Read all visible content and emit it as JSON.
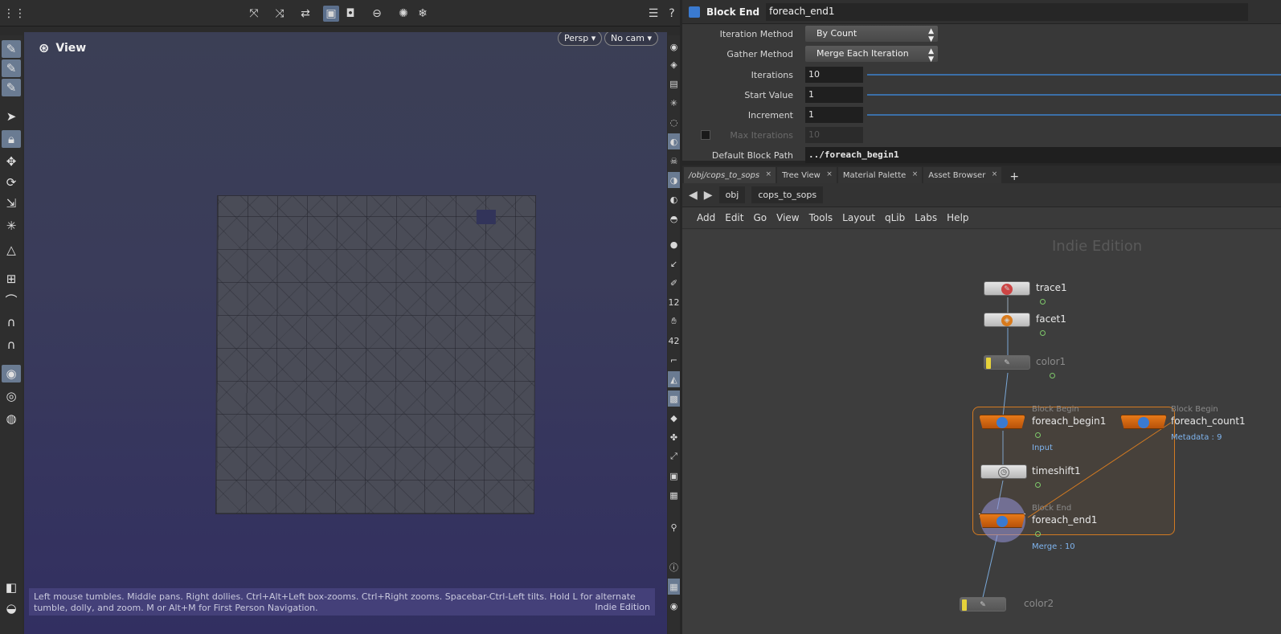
{
  "viewport": {
    "view_label": "View",
    "persp_button": "Persp ▾",
    "cam_button": "No cam ▾",
    "status_text": "Left mouse tumbles. Middle pans. Right dollies. Ctrl+Alt+Left box-zooms. Ctrl+Right zooms. Spacebar-Ctrl-Left tilts. Hold L for alternate tumble, dolly, and zoom. M or Alt+M for First Person Navigation.",
    "status_edition": "Indie Edition",
    "help_icon": "?"
  },
  "params": {
    "node_type": "Block End",
    "node_name": "foreach_end1",
    "iteration_method_label": "Iteration Method",
    "iteration_method_value": "By Count",
    "gather_method_label": "Gather Method",
    "gather_method_value": "Merge Each Iteration",
    "iterations_label": "Iterations",
    "iterations_value": "10",
    "start_value_label": "Start Value",
    "start_value_value": "1",
    "increment_label": "Increment",
    "increment_value": "1",
    "max_iterations_label": "Max Iterations",
    "max_iterations_value": "10",
    "default_block_path_label": "Default Block Path",
    "default_block_path_value": "../foreach_begin1"
  },
  "network": {
    "tabs": [
      {
        "label": "/obj/cops_to_sops"
      },
      {
        "label": "Tree View"
      },
      {
        "label": "Material Palette"
      },
      {
        "label": "Asset Browser"
      }
    ],
    "tab_plus": "+",
    "path": [
      "obj",
      "cops_to_sops"
    ],
    "menu": [
      "Add",
      "Edit",
      "Go",
      "View",
      "Tools",
      "Layout",
      "qLib",
      "Labs",
      "Help"
    ],
    "watermark": "Indie Edition",
    "nodes": {
      "trace1": {
        "name": "trace1"
      },
      "facet1": {
        "name": "facet1"
      },
      "color1": {
        "name": "color1"
      },
      "foreach_begin1": {
        "type": "Block Begin",
        "name": "foreach_begin1",
        "info": "Input"
      },
      "foreach_count1": {
        "type": "Block Begin",
        "name": "foreach_count1",
        "info": "Metadata : 9"
      },
      "timeshift1": {
        "name": "timeshift1"
      },
      "foreach_end1": {
        "type": "Block End",
        "name": "foreach_end1",
        "info": "Merge : 10"
      },
      "color2": {
        "name": "color2"
      }
    }
  },
  "colors": {
    "accent_blue": "#3b6fa8",
    "block_orange": "#e77a19",
    "viewport_top": "#3b3f55",
    "viewport_bottom": "#322f61",
    "info_blue": "#7fb4ee"
  }
}
